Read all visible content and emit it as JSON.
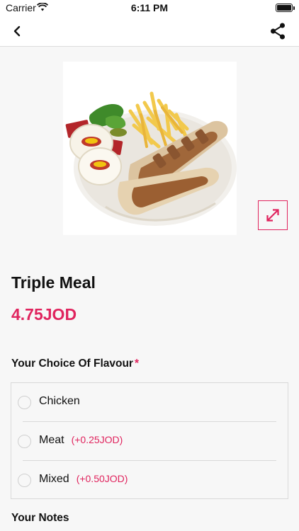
{
  "status_bar": {
    "carrier": "Carrier",
    "time": "6:11 PM",
    "battery_level": 1.0
  },
  "nav": {
    "back_icon": "chevron-left-icon",
    "share_icon": "share-icon"
  },
  "product": {
    "image_icon": "food-photo",
    "expand_icon": "expand-arrows-icon",
    "title": "Triple Meal",
    "price": "4.75JOD"
  },
  "flavour": {
    "title": "Your Choice Of Flavour",
    "required_mark": "*",
    "options": [
      {
        "label": "Chicken",
        "extra": ""
      },
      {
        "label": "Meat",
        "extra": "(+0.25JOD)"
      },
      {
        "label": "Mixed",
        "extra": "(+0.50JOD)"
      }
    ]
  },
  "notes": {
    "title": "Your Notes"
  },
  "colors": {
    "accent": "#e0245e",
    "background": "#f7f7f7",
    "border": "#d9d9d9"
  }
}
